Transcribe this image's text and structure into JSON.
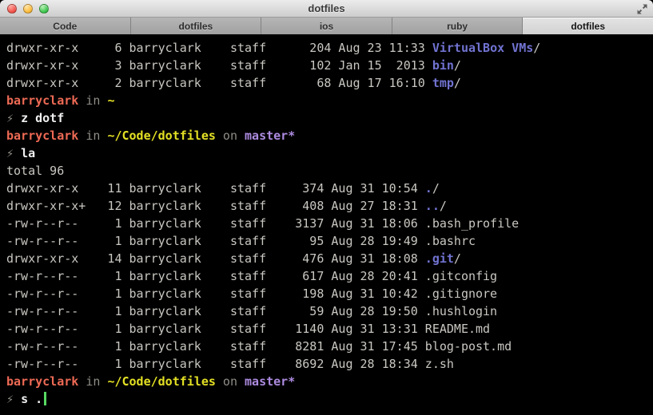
{
  "window": {
    "title": "dotfiles",
    "controls": {
      "close": "close-button",
      "minimize": "minimize-button",
      "zoom": "zoom-button",
      "fullscreen": "fullscreen-arrows-icon"
    }
  },
  "tabs": [
    {
      "label": "Code",
      "active": false
    },
    {
      "label": "dotfiles",
      "active": false
    },
    {
      "label": "ios",
      "active": false
    },
    {
      "label": "ruby",
      "active": false
    },
    {
      "label": "dotfiles",
      "active": true
    }
  ],
  "palette": {
    "term_bg": "#000000",
    "term_fg": "#c9c7c1",
    "cmd": "#efefef",
    "user": "#ee6a55",
    "dim": "#8f8d86",
    "path": "#e3e024",
    "branch": "#ad8be0",
    "dir": "#7173d2",
    "cursor": "#57d963"
  },
  "terminal": {
    "lines": [
      [
        {
          "t": "drwxr-xr-x     6 barryclark    staff      204 Aug 23 11:33 ",
          "c": "fg"
        },
        {
          "t": "VirtualBox VMs",
          "c": "dir"
        },
        {
          "t": "/",
          "c": "fg"
        }
      ],
      [
        {
          "t": "drwxr-xr-x     3 barryclark    staff      102 Jan 15  2013 ",
          "c": "fg"
        },
        {
          "t": "bin",
          "c": "dir"
        },
        {
          "t": "/",
          "c": "fg"
        }
      ],
      [
        {
          "t": "drwxr-xr-x     2 barryclark    staff       68 Aug 17 16:10 ",
          "c": "fg"
        },
        {
          "t": "tmp",
          "c": "dir"
        },
        {
          "t": "/",
          "c": "fg"
        }
      ],
      [
        {
          "t": "barryclark",
          "c": "user"
        },
        {
          "t": " in ",
          "c": "dim"
        },
        {
          "t": "~",
          "c": "path"
        }
      ],
      [
        {
          "t": "⚡ ",
          "c": "dim"
        },
        {
          "t": "z dotf",
          "c": "cmd"
        }
      ],
      [
        {
          "t": "barryclark",
          "c": "user"
        },
        {
          "t": " in ",
          "c": "dim"
        },
        {
          "t": "~/Code/dotfiles",
          "c": "path"
        },
        {
          "t": " on ",
          "c": "dim"
        },
        {
          "t": "master*",
          "c": "branch"
        }
      ],
      [
        {
          "t": "⚡ ",
          "c": "dim"
        },
        {
          "t": "la",
          "c": "cmd"
        }
      ],
      [
        {
          "t": "total 96",
          "c": "fg"
        }
      ],
      [
        {
          "t": "drwxr-xr-x    11 barryclark    staff     374 Aug 31 10:54 ",
          "c": "fg"
        },
        {
          "t": ".",
          "c": "dir"
        },
        {
          "t": "/",
          "c": "fg"
        }
      ],
      [
        {
          "t": "drwxr-xr-x+   12 barryclark    staff     408 Aug 27 18:31 ",
          "c": "fg"
        },
        {
          "t": "..",
          "c": "dir"
        },
        {
          "t": "/",
          "c": "fg"
        }
      ],
      [
        {
          "t": "-rw-r--r--     1 barryclark    staff    3137 Aug 31 18:06 .bash_profile",
          "c": "fg"
        }
      ],
      [
        {
          "t": "-rw-r--r--     1 barryclark    staff      95 Aug 28 19:49 .bashrc",
          "c": "fg"
        }
      ],
      [
        {
          "t": "drwxr-xr-x    14 barryclark    staff     476 Aug 31 18:08 ",
          "c": "fg"
        },
        {
          "t": ".git",
          "c": "dir"
        },
        {
          "t": "/",
          "c": "fg"
        }
      ],
      [
        {
          "t": "-rw-r--r--     1 barryclark    staff     617 Aug 28 20:41 .gitconfig",
          "c": "fg"
        }
      ],
      [
        {
          "t": "-rw-r--r--     1 barryclark    staff     198 Aug 31 10:42 .gitignore",
          "c": "fg"
        }
      ],
      [
        {
          "t": "-rw-r--r--     1 barryclark    staff      59 Aug 28 19:50 .hushlogin",
          "c": "fg"
        }
      ],
      [
        {
          "t": "-rw-r--r--     1 barryclark    staff    1140 Aug 31 13:31 README.md",
          "c": "fg"
        }
      ],
      [
        {
          "t": "-rw-r--r--     1 barryclark    staff    8281 Aug 31 17:45 blog-post.md",
          "c": "fg"
        }
      ],
      [
        {
          "t": "-rw-r--r--     1 barryclark    staff    8692 Aug 28 18:34 z.sh",
          "c": "fg"
        }
      ],
      [
        {
          "t": "barryclark",
          "c": "user"
        },
        {
          "t": " in ",
          "c": "dim"
        },
        {
          "t": "~/Code/dotfiles",
          "c": "path"
        },
        {
          "t": " on ",
          "c": "dim"
        },
        {
          "t": "master*",
          "c": "branch"
        }
      ],
      [
        {
          "t": "⚡ ",
          "c": "dim"
        },
        {
          "t": "s .",
          "c": "cmd"
        },
        {
          "cursor": true
        }
      ]
    ]
  }
}
